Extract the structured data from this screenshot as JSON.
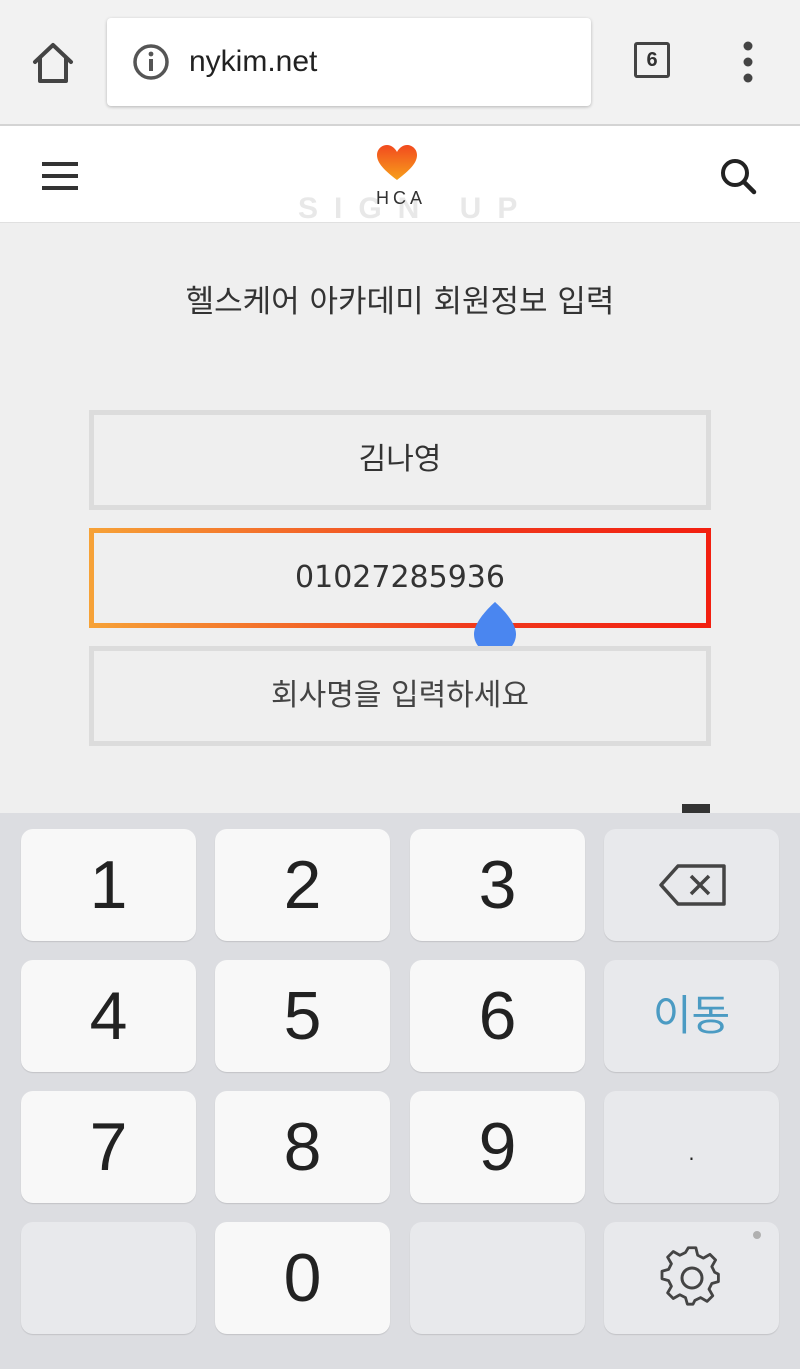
{
  "browser": {
    "url": "nykim.net",
    "tab_count": "6"
  },
  "header": {
    "logo_text": "HCA",
    "watermark": "SIGN UP"
  },
  "main": {
    "heading": "헬스케어 아카데미 회원정보 입력",
    "fields": {
      "name_value": "김나영",
      "phone_value": "01027285936",
      "company_placeholder": "회사명을 입력하세요"
    }
  },
  "keyboard": {
    "keys": [
      "1",
      "2",
      "3",
      "4",
      "5",
      "6",
      "7",
      "8",
      "9",
      "0"
    ],
    "move_label": "이동",
    "dot_label": "."
  },
  "colors": {
    "accent_start": "#f6a237",
    "accent_end": "#f21f10",
    "cursor": "#4a86f0",
    "move_key": "#4b9bc3"
  },
  "icons": [
    "home-icon",
    "info-icon",
    "tab-switcher-icon",
    "more-vert-icon",
    "hamburger-icon",
    "heart-logo-icon",
    "search-icon",
    "backspace-icon",
    "settings-gear-icon",
    "text-cursor-handle-icon"
  ]
}
